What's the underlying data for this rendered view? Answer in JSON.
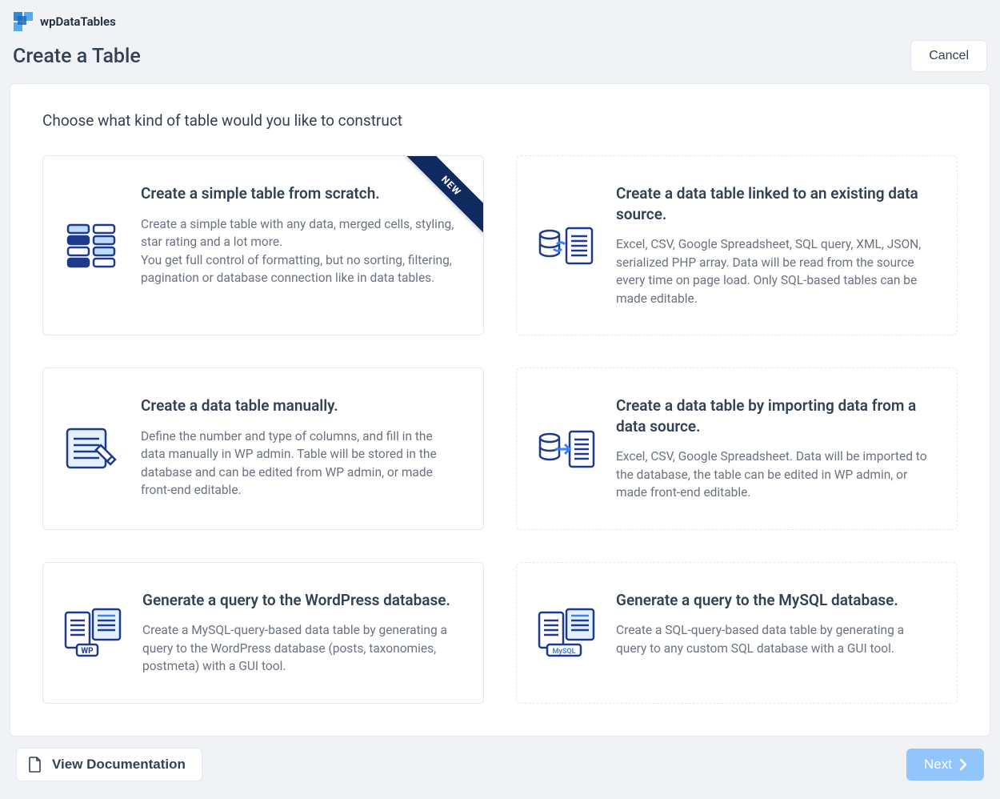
{
  "header": {
    "brand": "wpDataTables",
    "page_title": "Create a Table",
    "cancel_label": "Cancel"
  },
  "subheading": "Choose what kind of table would you like to construct",
  "cards": {
    "simple": {
      "title": "Create a simple table from scratch.",
      "desc": "Create a simple table with any data, merged cells, styling, star rating and a lot more.\nYou get full control of formatting, but no sorting, filtering, pagination or database connection like in data tables.",
      "badge": "NEW"
    },
    "linked": {
      "title": "Create a data table linked to an existing data source.",
      "desc": "Excel, CSV, Google Spreadsheet, SQL query, XML, JSON, serialized PHP array. Data will be read from the source every time on page load. Only SQL-based tables can be made editable."
    },
    "manual": {
      "title": "Create a data table manually.",
      "desc": "Define the number and type of columns, and fill in the data manually in WP admin. Table will be stored in the database and can be edited from WP admin, or made front-end editable."
    },
    "import": {
      "title": "Create a data table by importing data from a data source.",
      "desc": "Excel, CSV, Google Spreadsheet. Data will be imported to the database, the table can be edited in WP admin, or made front-end editable."
    },
    "wpquery": {
      "title": "Generate a query to the WordPress database.",
      "desc": "Create a MySQL-query-based data table by generating a query to the WordPress database (posts, taxonomies, postmeta) with a GUI tool."
    },
    "mysql": {
      "title": "Generate a query to the MySQL database.",
      "desc": "Create a SQL-query-based data table by generating a query to any custom SQL database with a GUI tool."
    }
  },
  "footer": {
    "doc_label": "View Documentation",
    "next_label": "Next"
  }
}
